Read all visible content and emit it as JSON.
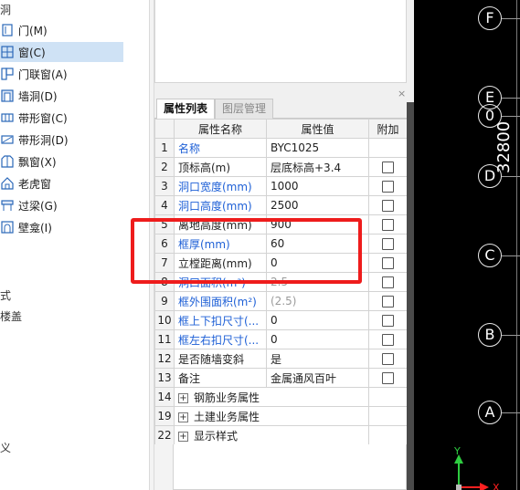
{
  "left_tree": {
    "header": "洞",
    "items": [
      {
        "label": "门(M)",
        "icon": "door-icon",
        "selected": false
      },
      {
        "label": "窗(C)",
        "icon": "window-icon",
        "selected": true
      },
      {
        "label": "门联窗(A)",
        "icon": "door-window-icon",
        "selected": false
      },
      {
        "label": "墙洞(D)",
        "icon": "wall-opening-icon",
        "selected": false
      },
      {
        "label": "带形窗(C)",
        "icon": "strip-window-icon",
        "selected": false
      },
      {
        "label": "带形洞(D)",
        "icon": "strip-opening-icon",
        "selected": false
      },
      {
        "label": "飘窗(X)",
        "icon": "bay-window-icon",
        "selected": false
      },
      {
        "label": "老虎窗",
        "icon": "dormer-icon",
        "selected": false
      },
      {
        "label": "过梁(G)",
        "icon": "lintel-icon",
        "selected": false
      },
      {
        "label": "壁龛(I)",
        "icon": "niche-icon",
        "selected": false
      }
    ],
    "cut_items": [
      "式",
      "楼盖",
      "",
      "",
      "",
      "",
      "",
      "义"
    ]
  },
  "panel": {
    "tab_active": "属性列表",
    "tab_inactive": "图层管理",
    "close": "×",
    "columns": [
      "属性名称",
      "属性值",
      "附加"
    ],
    "rows": [
      {
        "num": "1",
        "name": "名称",
        "value": "BYC1025",
        "name_color": "blue",
        "value_color": "dark",
        "check": false
      },
      {
        "num": "2",
        "name": "顶标高(m)",
        "value": "层底标高+3.4",
        "name_color": "dark",
        "value_color": "dark",
        "check": true
      },
      {
        "num": "3",
        "name": "洞口宽度(mm)",
        "value": "1000",
        "name_color": "blue",
        "value_color": "dark",
        "check": true
      },
      {
        "num": "4",
        "name": "洞口高度(mm)",
        "value": "2500",
        "name_color": "blue",
        "value_color": "dark",
        "check": true
      },
      {
        "num": "5",
        "name": "离地高度(mm)",
        "value": "900",
        "name_color": "dark",
        "value_color": "dark",
        "check": true
      },
      {
        "num": "6",
        "name": "框厚(mm)",
        "value": "60",
        "name_color": "blue",
        "value_color": "dark",
        "check": true
      },
      {
        "num": "7",
        "name": "立樘距离(mm)",
        "value": "0",
        "name_color": "dark",
        "value_color": "dark",
        "check": true
      },
      {
        "num": "8",
        "name": "洞口面积(m²)",
        "value": "2.5",
        "name_color": "blue",
        "value_color": "gray",
        "check": true
      },
      {
        "num": "9",
        "name": "框外围面积(m²)",
        "value": "(2.5)",
        "name_color": "blue",
        "value_color": "gray",
        "check": true
      },
      {
        "num": "10",
        "name": "框上下扣尺寸(...",
        "value": "0",
        "name_color": "blue",
        "value_color": "dark",
        "check": true
      },
      {
        "num": "11",
        "name": "框左右扣尺寸(...",
        "value": "0",
        "name_color": "blue",
        "value_color": "dark",
        "check": true
      },
      {
        "num": "12",
        "name": "是否随墙变斜",
        "value": "是",
        "name_color": "dark",
        "value_color": "dark",
        "check": true
      },
      {
        "num": "13",
        "name": "备注",
        "value": "金属通风百叶",
        "name_color": "dark",
        "value_color": "dark",
        "check": true
      }
    ],
    "groups": [
      {
        "num": "14",
        "label": "钢筋业务属性"
      },
      {
        "num": "19",
        "label": "土建业务属性"
      },
      {
        "num": "22",
        "label": "显示样式"
      }
    ],
    "group_expand_symbol": "+"
  },
  "canvas": {
    "axes": [
      "F",
      "E",
      "0",
      "D",
      "C",
      "B",
      "A"
    ],
    "dimension": "32800",
    "ucs_y": "Y",
    "ucs_x": "X",
    "colors": {
      "background": "#000000",
      "y_axis": "#2ecc40",
      "x_axis": "#ff2020",
      "highlight": "#ee1c1c"
    }
  }
}
